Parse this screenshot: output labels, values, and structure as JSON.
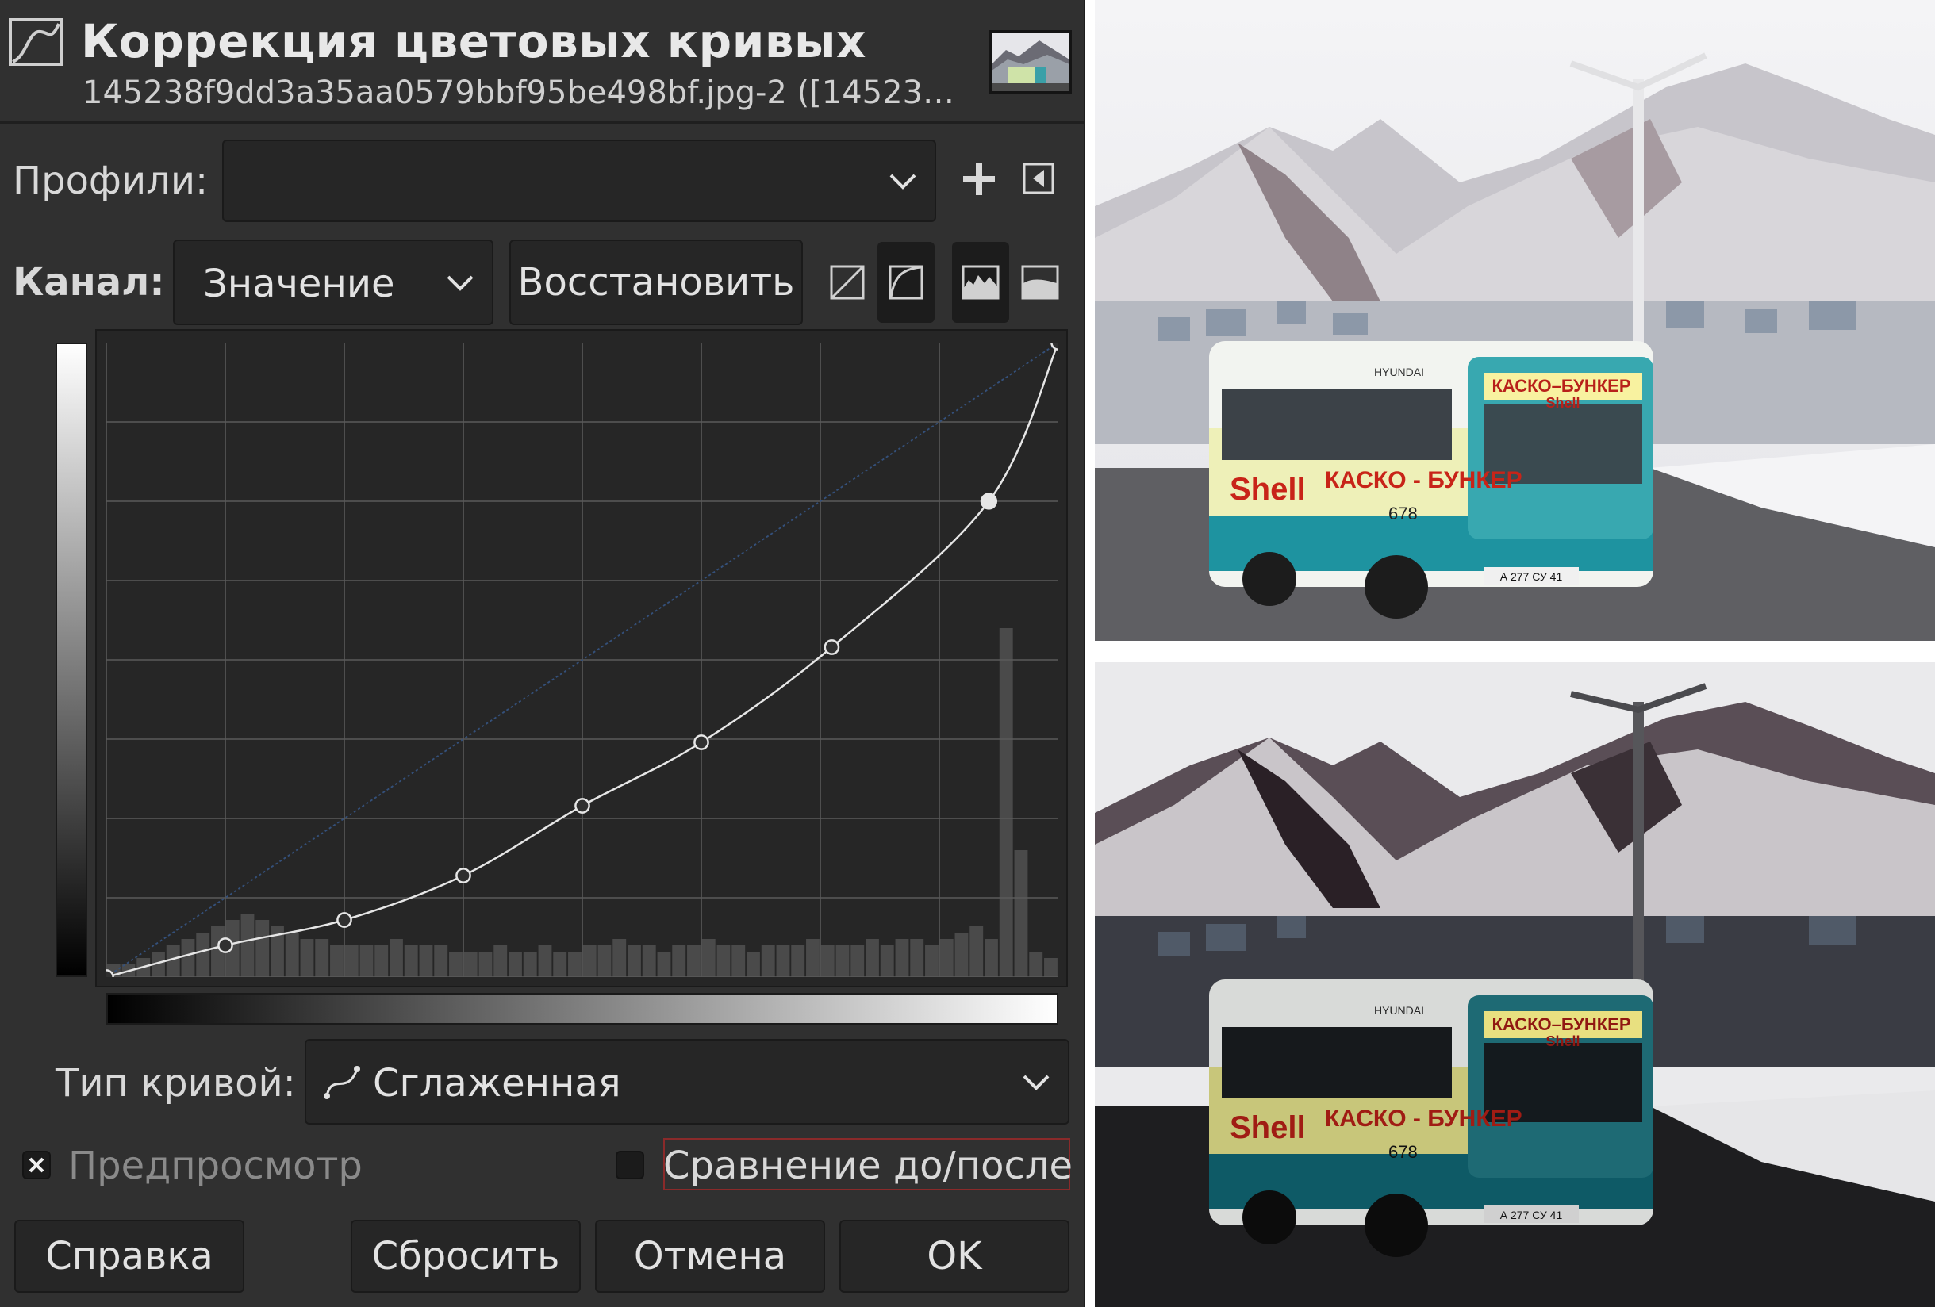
{
  "dialog": {
    "title": "Коррекция цветовых кривых",
    "subtitle": "145238f9dd3a35aa0579bbf95be498bf.jpg-2 ([14523…"
  },
  "profiles": {
    "label": "Профили:",
    "value": ""
  },
  "channel": {
    "label": "Канал:",
    "value": "Значение",
    "reset_label": "Восстановить",
    "toolbar_icons": [
      "linear-histogram-icon",
      "logarithmic-histogram-icon",
      "histogram-icon",
      "histogram-alt-icon"
    ]
  },
  "curve_type": {
    "label": "Тип кривой:",
    "value": "Сглаженная",
    "icon": "smooth-curve-icon"
  },
  "preview": {
    "label": "Предпросмотр",
    "checked": true
  },
  "compare": {
    "label": "Сравнение до/после",
    "checked": false
  },
  "buttons": {
    "help": "Справка",
    "reset": "Сбросить",
    "cancel": "Отмена",
    "ok": "OK"
  },
  "curve": {
    "points": [
      [
        0,
        0
      ],
      [
        0.125,
        0.05
      ],
      [
        0.25,
        0.09
      ],
      [
        0.375,
        0.16
      ],
      [
        0.5,
        0.27
      ],
      [
        0.625,
        0.37
      ],
      [
        0.762,
        0.52
      ],
      [
        0.927,
        0.75
      ],
      [
        1,
        1
      ]
    ],
    "selected_index": 7
  },
  "histogram": [
    0.02,
    0.02,
    0.03,
    0.04,
    0.05,
    0.06,
    0.07,
    0.08,
    0.09,
    0.1,
    0.09,
    0.08,
    0.07,
    0.06,
    0.06,
    0.05,
    0.05,
    0.05,
    0.05,
    0.06,
    0.05,
    0.05,
    0.05,
    0.04,
    0.04,
    0.04,
    0.05,
    0.04,
    0.04,
    0.05,
    0.04,
    0.04,
    0.05,
    0.05,
    0.06,
    0.05,
    0.05,
    0.04,
    0.05,
    0.05,
    0.06,
    0.05,
    0.05,
    0.04,
    0.05,
    0.05,
    0.05,
    0.06,
    0.05,
    0.05,
    0.05,
    0.06,
    0.05,
    0.06,
    0.06,
    0.05,
    0.06,
    0.07,
    0.08,
    0.06,
    0.55,
    0.2,
    0.04,
    0.03
  ],
  "colors": {
    "panel": "#303030",
    "field": "#262626",
    "grid": "#5a5a5a",
    "curve": "#e6e6e6",
    "diagonal": "#34507a",
    "highlight_border": "#8a2a2a"
  },
  "photos": {
    "top": {
      "bus_route": "КАСКО–БУНКЕР",
      "brand": "Shell",
      "ad_text": "КАСКО - БУНКЕР",
      "plate": "А 277 СУ 41",
      "fleet_no": "678",
      "make": "HYUNDAI"
    },
    "bottom": {
      "bus_route": "КАСКО–БУНКЕР",
      "brand": "Shell",
      "ad_text": "КАСКО - БУНКЕР",
      "plate": "А 277 СУ 41",
      "fleet_no": "678",
      "make": "HYUNDAI"
    }
  }
}
